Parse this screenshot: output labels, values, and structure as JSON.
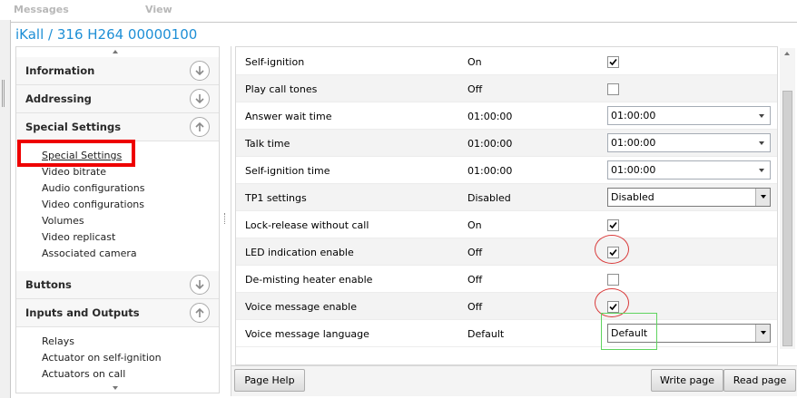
{
  "menubar": {
    "messages": "Messages",
    "view": "View"
  },
  "window": {
    "title": "iKall / 316 H264 00000100"
  },
  "nav": {
    "sections": [
      {
        "label": "Information",
        "icon": "chevron-circle-down-icon"
      },
      {
        "label": "Addressing",
        "icon": "chevron-circle-down-icon"
      },
      {
        "label": "Special Settings",
        "icon": "chevron-circle-up-icon"
      },
      {
        "label": "Buttons",
        "icon": "chevron-circle-down-icon"
      },
      {
        "label": "Inputs and Outputs",
        "icon": "chevron-circle-up-icon"
      }
    ],
    "special_items": [
      "Special Settings",
      "Video bitrate",
      "Audio configurations",
      "Video configurations",
      "Volumes",
      "Video replicast",
      "Associated camera"
    ],
    "io_items": [
      "Relays",
      "Actuator on self-ignition",
      "Actuators on call"
    ]
  },
  "settings": {
    "rows": [
      {
        "name": "Self-ignition",
        "value": "On",
        "control": "checkbox",
        "checked": true
      },
      {
        "name": "Play call tones",
        "value": "Off",
        "control": "checkbox",
        "checked": false
      },
      {
        "name": "Answer wait time",
        "value": "01:00:00",
        "control": "select",
        "selected": "01:00:00"
      },
      {
        "name": "Talk time",
        "value": "01:00:00",
        "control": "select",
        "selected": "01:00:00"
      },
      {
        "name": "Self-ignition time",
        "value": "01:00:00",
        "control": "select",
        "selected": "01:00:00"
      },
      {
        "name": "TP1 settings",
        "value": "Disabled",
        "control": "select-boxed",
        "selected": "Disabled"
      },
      {
        "name": "Lock-release without call",
        "value": "On",
        "control": "checkbox",
        "checked": true
      },
      {
        "name": "LED indication enable",
        "value": "Off",
        "control": "checkbox",
        "checked": true
      },
      {
        "name": "De-misting heater enable",
        "value": "Off",
        "control": "checkbox",
        "checked": false
      },
      {
        "name": "Voice message enable",
        "value": "Off",
        "control": "checkbox",
        "checked": true
      },
      {
        "name": "Voice message language",
        "value": "Default",
        "control": "select-boxed",
        "selected": "Default"
      }
    ]
  },
  "buttons": {
    "page_help": "Page Help",
    "write_page": "Write page",
    "read_page": "Read page"
  },
  "colors": {
    "title_blue": "#1e8fd6",
    "highlight_red": "#ee0000",
    "annotation_red": "#d93a3a",
    "annotation_green": "#5fd45f"
  }
}
